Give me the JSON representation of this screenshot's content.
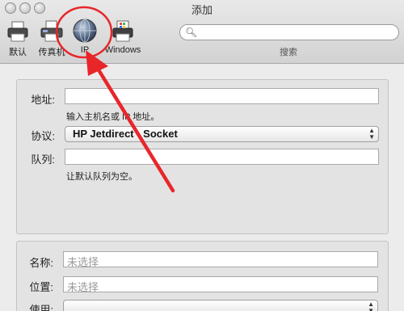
{
  "window": {
    "title": "添加"
  },
  "toolbar": {
    "items": [
      {
        "label": "默认",
        "icon": "printer-icon"
      },
      {
        "label": "传真机",
        "icon": "fax-icon"
      },
      {
        "label": "IP",
        "icon": "globe-icon"
      },
      {
        "label": "Windows",
        "icon": "windows-printer-icon"
      }
    ],
    "search_caption": "搜索"
  },
  "form": {
    "address_label": "地址:",
    "address_value": "",
    "address_hint": "输入主机名或 IP 地址。",
    "protocol_label": "协议:",
    "protocol_value": "HP Jetdirect - Socket",
    "queue_label": "队列:",
    "queue_value": "",
    "queue_hint": "让默认队列为空。"
  },
  "details": {
    "name_label": "名称:",
    "name_placeholder": "未选择",
    "location_label": "位置:",
    "location_placeholder": "未选择",
    "use_label": "使用:"
  },
  "annotation": {
    "color": "#e8262a"
  }
}
